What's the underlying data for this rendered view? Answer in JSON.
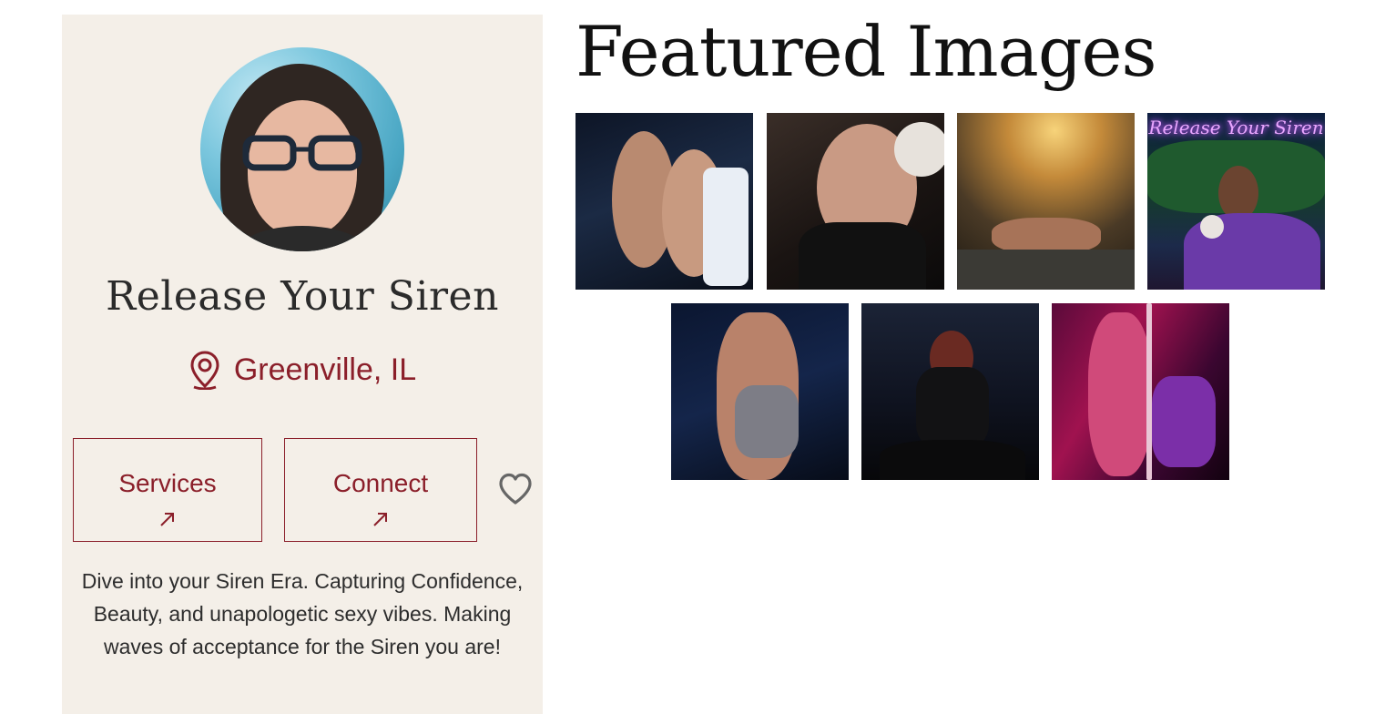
{
  "profile": {
    "name": "Release Your Siren",
    "location": "Greenville, IL",
    "services_label": "Services",
    "connect_label": "Connect",
    "description": "Dive into your Siren Era. Capturing Confidence, Beauty, and unapologetic sexy vibes. Making waves of acceptance for the Siren you are!"
  },
  "icons": {
    "location": "map-pin-icon",
    "services_arrow": "arrow-up-right-icon",
    "connect_arrow": "arrow-up-right-icon",
    "favorite": "heart-icon"
  },
  "colors": {
    "accent": "#8b1f2a",
    "card_background": "#f4efe8"
  },
  "featured": {
    "title": "Featured Images",
    "images": [
      {
        "name": "featured-image-1"
      },
      {
        "name": "featured-image-2"
      },
      {
        "name": "featured-image-3"
      },
      {
        "name": "featured-image-4",
        "neon_text": "Release Your Siren"
      },
      {
        "name": "featured-image-5"
      },
      {
        "name": "featured-image-6"
      },
      {
        "name": "featured-image-7"
      }
    ]
  }
}
